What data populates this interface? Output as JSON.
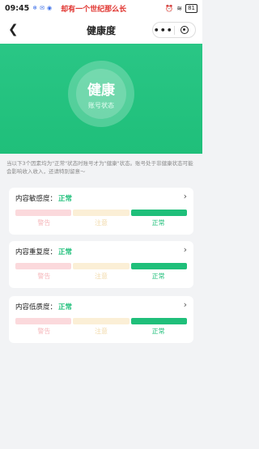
{
  "status_bar": {
    "time": "09:45",
    "banner": "却有一个世纪那么长",
    "battery": "81"
  },
  "nav": {
    "back_icon": "chevron-left-icon",
    "title": "健康度",
    "more_icon": "ellipsis-icon",
    "close_icon": "target-close-icon"
  },
  "hero": {
    "status": "健康",
    "subtitle": "账号状态"
  },
  "notice": "当以下3个因素均为\"正常\"状态时账号才为\"健康\"状态。账号处于非健康状态可能会影响收入收入，还请特别留意～",
  "scale_labels": {
    "warn": "警告",
    "note": "注意",
    "ok": "正常"
  },
  "cards": [
    {
      "label": "内容敏感度：",
      "value": "正常"
    },
    {
      "label": "内容重复度：",
      "value": "正常"
    },
    {
      "label": "内容低质度：",
      "value": "正常"
    }
  ],
  "colors": {
    "brand_green": "#1fbf7a",
    "warn": "#fbd9dc",
    "note": "#fbefd6"
  }
}
